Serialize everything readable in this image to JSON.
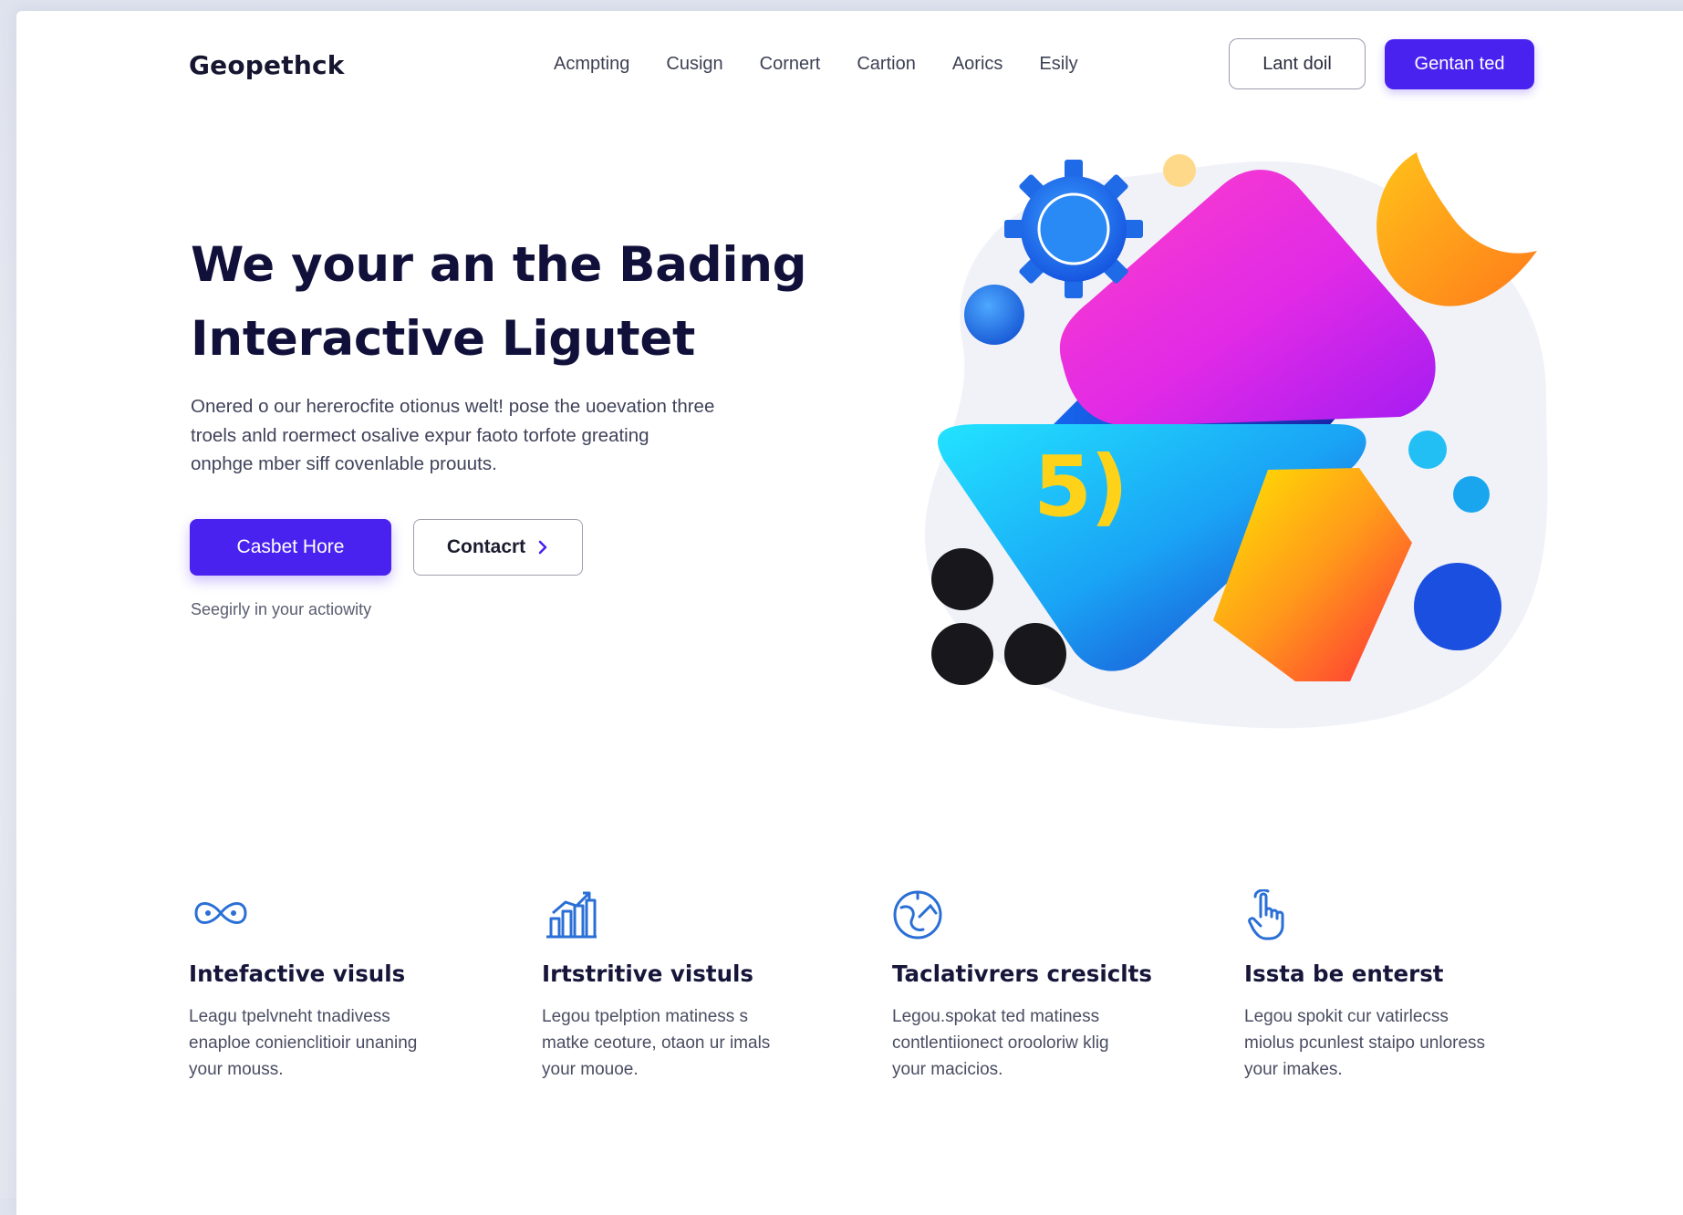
{
  "header": {
    "logo": "Geopethck",
    "nav": [
      "Acmpting",
      "Cusign",
      "Cornert",
      "Cartion",
      "Aorics",
      "Esily"
    ],
    "secondary_button": "Lant doil",
    "primary_button": "Gentan ted"
  },
  "hero": {
    "title_line1": "We your an the Bading",
    "title_line2": "Interactive Ligutet",
    "description_lines": [
      "Onered o our hererocfite otionus welt! pose the uoevation three",
      "troels anld roermect osalive expur faoto torfote greating",
      "onphge mber siff covenlable prouuts."
    ],
    "primary_cta": "Casbet Hore",
    "secondary_cta": "Contacrt",
    "note": "Seegirly in your actiowity",
    "art_text": "5)"
  },
  "features": [
    {
      "icon": "infinity-loop-icon",
      "title": "Intefactive visuls",
      "description_lines": [
        "Leagu tpelvneht tnadivess",
        "enaploe conienclitioir unaning",
        "your mouss."
      ]
    },
    {
      "icon": "bar-chart-growth-icon",
      "title": "Irtstritive vistuls",
      "description_lines": [
        "Legou tpelption matiness s",
        "matke ceoture, otaon ur imals",
        "your mouoe."
      ]
    },
    {
      "icon": "globe-chart-icon",
      "title": "Taclativrers cresiclts",
      "description_lines": [
        "Legou.spokat ted matiness",
        "contlentiionect orooloriw klig",
        "your macicios."
      ]
    },
    {
      "icon": "pointer-hand-icon",
      "title": "Issta be enterst",
      "description_lines": [
        "Legou spokit cur vatirlecss",
        "miolus pcunlest staipo unloress",
        "your imakes."
      ]
    }
  ],
  "colors": {
    "primary": "#4a22f0",
    "text_dark": "#10103a",
    "icon_blue": "#2a6fd6"
  }
}
